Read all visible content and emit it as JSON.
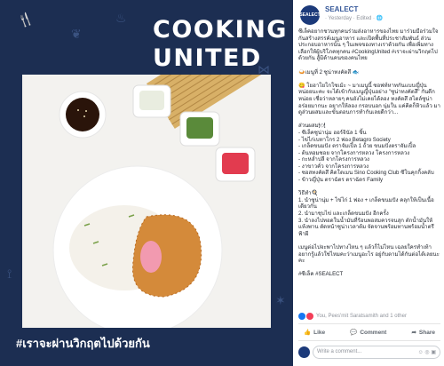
{
  "image": {
    "brand_title": "COOKING UNITED",
    "hashtag": "#เราจะผ่านวิกฤตไปด้วยกัน"
  },
  "post": {
    "page_name": "SEALECT",
    "avatar_text": "SEALECT",
    "meta": "· Yesterday · Edited · 🌐",
    "body": "ซีเล็คอยากชวนทุกคนร่วมส่งอาหารของไทย มาร่วมมือร่วมใจกันสร้างสรรค์เมนูอาหาร และเปิดพื้นที่ประชาสัมพันธ์ ส่วนประกอบอาหารนั้น ๆ ในเพจของทางเราด้วยกัน เพื่อเพิ่มทางเลือกให้ผู้บริโภคทุกคน #CookingUnited #เราจะผ่านวิกฤตไปด้วยกัน สู้มิด้านคนของคนไทย\n\n🍛เมนูที่ 2 ซูน่าทงคัตสึ 🐟\n\n😋 โยฮาโยโกโซเม้ะ ~ มาเมนูนี้ ซอฟท์หาทกันแบบญี่ปุ่นหน่อยนะคะ จะได้เข้ากับเมนูญี่ปุ่นอย่าง \"ซูน่าทงคัตสึ\" กันดีกหน่อย เชื่อว่าหลายๆ คนยังไม่เคยได้ลอง ทงคัตสึ สไตล์ซูน่า อร่อยมากนะ อยากให้ลอง กรอบนอก นุ่มใน แค่คิดก็หิวแล้ว มาดูส่วนผสมและขั้นตอนการทำกันเลยดีกว่า...\n\nส่วนผสม🍽\n- ซีเล็คซูน่านุ่ม ฮอร์จินัล 1 ชิ้น\n- ไข่ไก่เบทาโกร 2 ฟอง Betagro Society\n- เกล็ดขนมปัง ตราจัมเปิ้ล 1 ถ้วย ขนมปังตราจัมเปิ้ล\n- ต้นหอมซอย จากโครงการหลวง โครงการหลวง\n- กะหล่ำปลี จากโครงการหลวง\n- งาขาวคั่ว จากโครงการหลวง\n- ซอสทงคัตสึ คิดโดเมน Sino Cooking Club ซีโนคุกกิ้งคลับ\n- ข้าวญี่ปุ่น ตราฉัตร ตราฉัตร Family\n\nวิธีทำ🍳\n1. นำซูน่านุ่ม + ไข่ไก่ 1 ฟอง + เกล็ดขนมปัง คลุกให้เป็นเนื้อเดียวกัน\n2. นำมาชุบไข่ และเกล็ดขนมปัง อีกครั้ง\n3. นำลงไปทอดในน้ำมันที่ร้อนพอสมควรจนสุก ตักน้ำมันให้แห้งพาน ตัดหน้าซูน่าเวลาต้ม จัดจานพร้อมทานพร้อมน้ำตรีฟ้าผี\n\nเมนูต่อไปจะพาไปทางไหน ๆ แล้วก็ไม่ไหน เฉลยใครทำเท้า อยากรู้แล้วใช่ไหมคะว่าเมนูอะไร อยู่กับตามได้กันต่อได้เลยนะคะ\n\n#ซีเล็ค #SEALECT",
    "reactions_text": "You, Pees'mit Saratsamith and 1 other",
    "actions": {
      "like": "Like",
      "comment": "Comment",
      "share": "Share"
    },
    "comment_placeholder": "Write a comment..."
  },
  "colors": {
    "left_bg": "#1c2e52",
    "link": "#365899",
    "like_blue": "#1877f2",
    "love_red": "#f33e58"
  }
}
